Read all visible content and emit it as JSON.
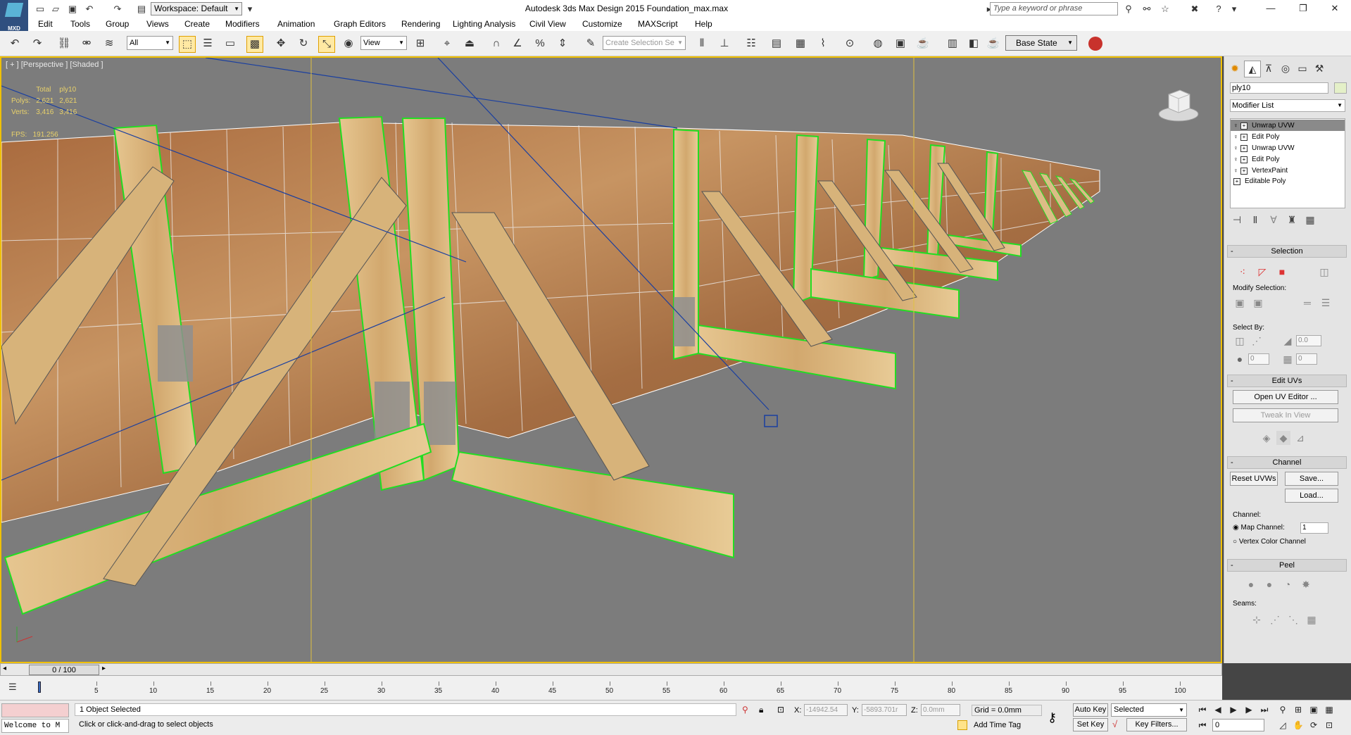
{
  "titlebar": {
    "app_logo": "MXD",
    "workspace": "Workspace: Default",
    "window_title": "Autodesk 3ds Max Design 2015      Foundation_max.max",
    "search_placeholder": "Type a keyword or phrase"
  },
  "menu": [
    "Edit",
    "Tools",
    "Group",
    "Views",
    "Create",
    "Modifiers",
    "Animation",
    "Graph Editors",
    "Rendering",
    "Lighting Analysis",
    "Civil View",
    "Customize",
    "MAXScript",
    "Help"
  ],
  "toolbar": {
    "selection_filter": "All",
    "ref_coord": "View",
    "named_selection_placeholder": "Create Selection Se",
    "base_state": "Base State"
  },
  "viewport": {
    "label": "[ + ] [Perspective ] [Shaded ]",
    "stats": {
      "header_total": "Total",
      "header_obj": "ply10",
      "rows": [
        {
          "label": "Polys:",
          "total": "2,621",
          "obj": "2,621"
        },
        {
          "label": "Verts:",
          "total": "3,416",
          "obj": "3,416"
        }
      ]
    },
    "fps_label": "FPS:",
    "fps_value": "191.256",
    "colors": {
      "background": "#7c7c7c",
      "selected_edge": "#22dd22",
      "plywood": "#b07a4a",
      "timber": "#d9b47c"
    }
  },
  "command_panel": {
    "object_name": "ply10",
    "modifier_list": "Modifier List",
    "stack": [
      "Unwrap UVW",
      "Edit Poly",
      "Unwrap UVW",
      "Edit Poly",
      "VertexPaint",
      "Editable Poly"
    ],
    "selection": {
      "title": "Selection",
      "modify_selection": "Modify Selection:",
      "select_by": "Select By:",
      "spin1": "0.0",
      "spin2": "0",
      "spin3": "0"
    },
    "edit_uvs": {
      "title": "Edit UVs",
      "open_uv_editor": "Open UV Editor ...",
      "tweak_in_view": "Tweak In View"
    },
    "channel": {
      "title": "Channel",
      "reset_uvws": "Reset UVWs",
      "save": "Save...",
      "load": "Load...",
      "channel_label": "Channel:",
      "map_channel": "Map Channel:",
      "map_channel_value": "1",
      "vertex_color_channel": "Vertex Color Channel"
    },
    "peel": {
      "title": "Peel",
      "seams": "Seams:"
    }
  },
  "timeline": {
    "frame_display": "0 / 100",
    "ticks": [
      "5",
      "10",
      "15",
      "20",
      "25",
      "30",
      "35",
      "40",
      "45",
      "50",
      "55",
      "60",
      "65",
      "70",
      "75",
      "80",
      "85",
      "90",
      "95",
      "100"
    ]
  },
  "statusbar": {
    "welcome": "Welcome to M",
    "selected_text": "1 Object Selected",
    "prompt": "Click or click-and-drag to select objects",
    "x_label": "X:",
    "x_value": "-14942.54",
    "y_label": "Y:",
    "y_value": "-5893.701r",
    "z_label": "Z:",
    "z_value": "0.0mm",
    "grid": "Grid = 0.0mm",
    "add_time_tag": "Add Time Tag",
    "auto_key": "Auto Key",
    "set_key": "Set Key",
    "key_mode": "Selected",
    "key_filters": "Key Filters...",
    "current_frame": "0"
  }
}
